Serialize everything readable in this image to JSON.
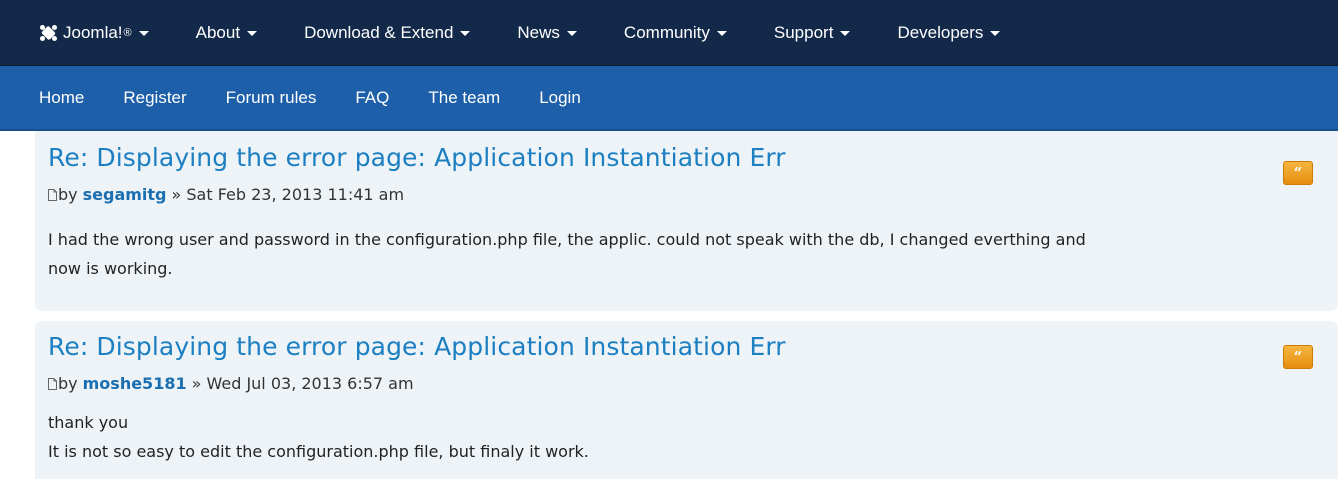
{
  "top_nav": {
    "brand": "Joomla!",
    "brand_sup": "®",
    "items": [
      "About",
      "Download & Extend",
      "News",
      "Community",
      "Support",
      "Developers"
    ]
  },
  "sub_nav": {
    "links": [
      "Home",
      "Register",
      "Forum rules",
      "FAQ",
      "The team",
      "Login"
    ]
  },
  "posts": [
    {
      "title": "Re: Displaying the error page: Application Instantiation Err",
      "by": "by",
      "author": "segamitg",
      "date": "» Sat Feb 23, 2013 11:41 am",
      "content_lines": [
        "I had the wrong user and password in the configuration.php file, the applic. could not speak with the db, I changed everthing and",
        "now is working."
      ],
      "quote_icon": "quote-icon"
    },
    {
      "title": "Re: Displaying the error page: Application Instantiation Err",
      "by": "by",
      "author": "moshe5181",
      "date": "» Wed Jul 03, 2013 6:57 am",
      "content_lines": [
        "thank you",
        "It is not so easy to edit the configuration.php file, but finaly it work."
      ],
      "quote_icon": "quote-icon"
    }
  ],
  "colors": {
    "top_nav_bg": "#13294a",
    "sub_nav_bg": "#1d5fa8",
    "post_bg": "#eef3f7",
    "title_link": "#1b7fc2",
    "author_link": "#1b6fb0",
    "quote_button": "#f0a52a"
  }
}
